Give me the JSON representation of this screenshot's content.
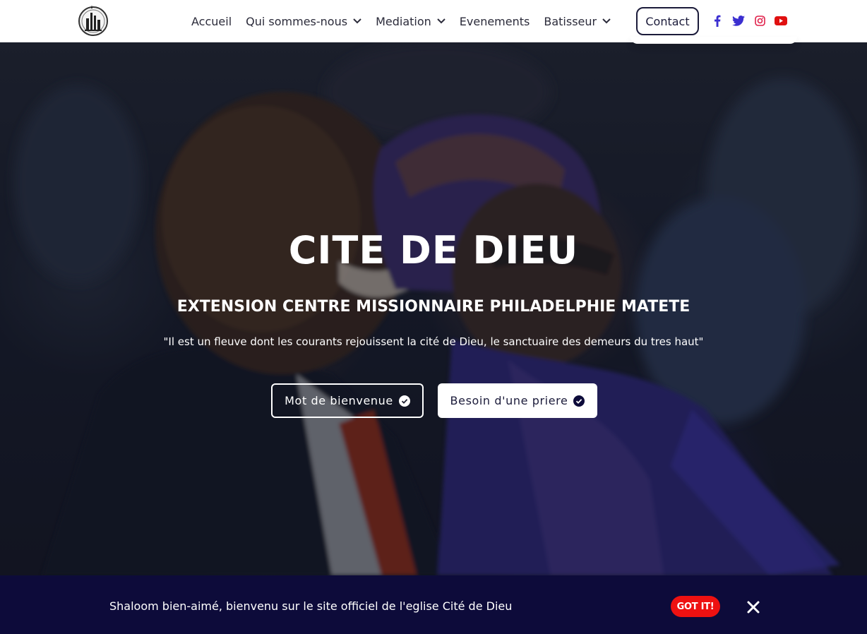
{
  "nav": {
    "logo_icon": "church-logo-icon",
    "items": [
      {
        "label": "Accueil",
        "has_dropdown": false
      },
      {
        "label": "Qui sommes-nous",
        "has_dropdown": true
      },
      {
        "label": "Mediation",
        "has_dropdown": true
      },
      {
        "label": "Evenements",
        "has_dropdown": false
      },
      {
        "label": "Batisseur",
        "has_dropdown": true
      }
    ],
    "contact_label": "Contact",
    "social": [
      {
        "icon": "facebook-icon",
        "color": "#3b2fd0"
      },
      {
        "icon": "twitter-icon",
        "color": "#3b2fd0"
      },
      {
        "icon": "instagram-icon",
        "color": "#e0204a"
      },
      {
        "icon": "youtube-icon",
        "color": "#e01010"
      }
    ]
  },
  "hero": {
    "title": "CITE DE DIEU",
    "subtitle": "EXTENSION CENTRE MISSIONNAIRE PHILADELPHIE MATETE",
    "quote": "\"Il est un fleuve dont les courants rejouissent la cité de Dieu, le sanctuaire des demeurs du tres haut\"",
    "welcome_button": "Mot de bienvenue",
    "prayer_button": "Besoin d'une priere",
    "button_icon": "check-circle-icon"
  },
  "cookie": {
    "message": "Shaloom bien-aimé, bienvenu sur le site officiel de l'eglise Cité de Dieu",
    "accept_label": "GOT IT!",
    "close_icon": "close-icon"
  },
  "colors": {
    "navy": "#0d0b3a",
    "accent_red": "#ee1111",
    "nav_text": "#2b2b3a"
  }
}
